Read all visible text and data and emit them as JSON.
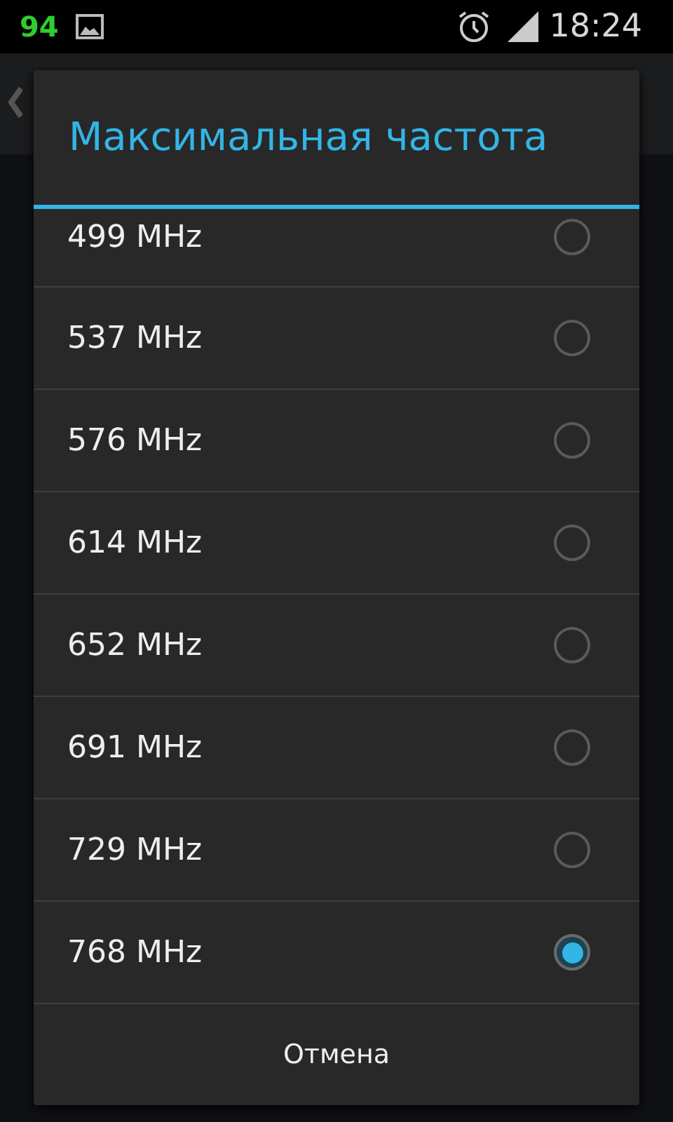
{
  "status_bar": {
    "battery_level_text": "94",
    "time": "18:24"
  },
  "dialog": {
    "title": "Максимальная частота",
    "options": [
      {
        "label": "499 MHz",
        "selected": false
      },
      {
        "label": "537 MHz",
        "selected": false
      },
      {
        "label": "576 MHz",
        "selected": false
      },
      {
        "label": "614 MHz",
        "selected": false
      },
      {
        "label": "652 MHz",
        "selected": false
      },
      {
        "label": "691 MHz",
        "selected": false
      },
      {
        "label": "729 MHz",
        "selected": false
      },
      {
        "label": "768 MHz",
        "selected": true
      }
    ],
    "cancel_button": "Отмена"
  }
}
